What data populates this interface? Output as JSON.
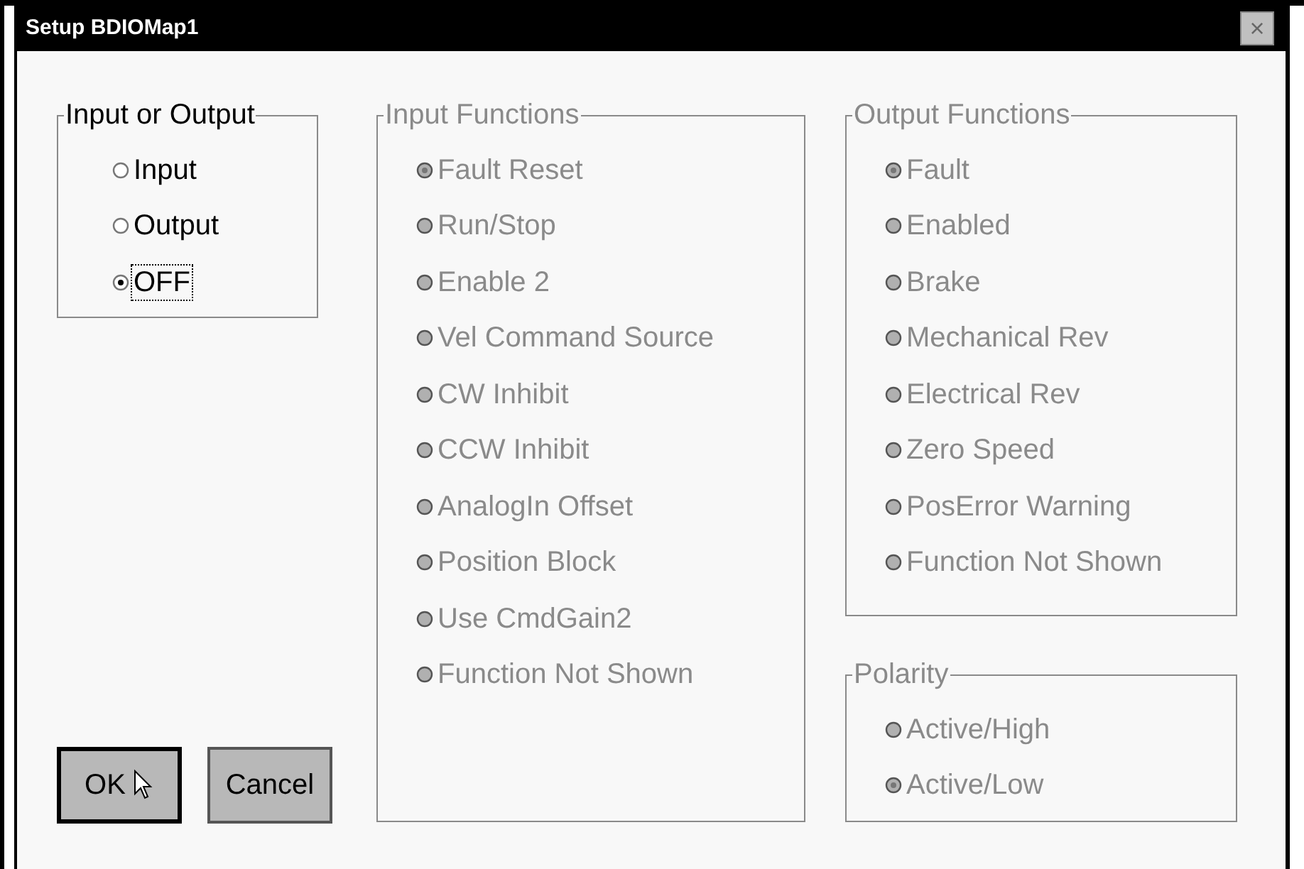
{
  "window": {
    "title": "Setup BDIOMap1",
    "close": "×"
  },
  "groups": [
    {
      "title": "Input or Output",
      "disabled": false,
      "options": [
        {
          "label": "Input",
          "selected": false,
          "focused": false
        },
        {
          "label": "Output",
          "selected": false,
          "focused": false
        },
        {
          "label": "OFF",
          "selected": true,
          "focused": true
        }
      ]
    },
    {
      "title": "Input Functions",
      "disabled": true,
      "options": [
        {
          "label": "Fault Reset",
          "selected": true,
          "focused": false
        },
        {
          "label": "Run/Stop",
          "selected": false,
          "focused": false
        },
        {
          "label": "Enable 2",
          "selected": false,
          "focused": false
        },
        {
          "label": "Vel Command Source",
          "selected": false,
          "focused": false
        },
        {
          "label": "CW Inhibit",
          "selected": false,
          "focused": false
        },
        {
          "label": "CCW Inhibit",
          "selected": false,
          "focused": false
        },
        {
          "label": "AnalogIn Offset",
          "selected": false,
          "focused": false
        },
        {
          "label": "Position Block",
          "selected": false,
          "focused": false
        },
        {
          "label": "Use CmdGain2",
          "selected": false,
          "focused": false
        },
        {
          "label": "Function Not Shown",
          "selected": false,
          "focused": false
        }
      ]
    },
    {
      "title": "Output Functions",
      "disabled": true,
      "options": [
        {
          "label": "Fault",
          "selected": true,
          "focused": false
        },
        {
          "label": "Enabled",
          "selected": false,
          "focused": false
        },
        {
          "label": "Brake",
          "selected": false,
          "focused": false
        },
        {
          "label": "Mechanical Rev",
          "selected": false,
          "focused": false
        },
        {
          "label": "Electrical Rev",
          "selected": false,
          "focused": false
        },
        {
          "label": "Zero Speed",
          "selected": false,
          "focused": false
        },
        {
          "label": "PosError Warning",
          "selected": false,
          "focused": false
        },
        {
          "label": "Function Not Shown",
          "selected": false,
          "focused": false
        }
      ]
    },
    {
      "title": "Polarity",
      "disabled": true,
      "options": [
        {
          "label": "Active/High",
          "selected": false,
          "focused": false
        },
        {
          "label": "Active/Low",
          "selected": true,
          "focused": false
        }
      ]
    }
  ],
  "buttons": [
    {
      "label": "OK",
      "default": true
    },
    {
      "label": "Cancel",
      "default": false
    }
  ]
}
